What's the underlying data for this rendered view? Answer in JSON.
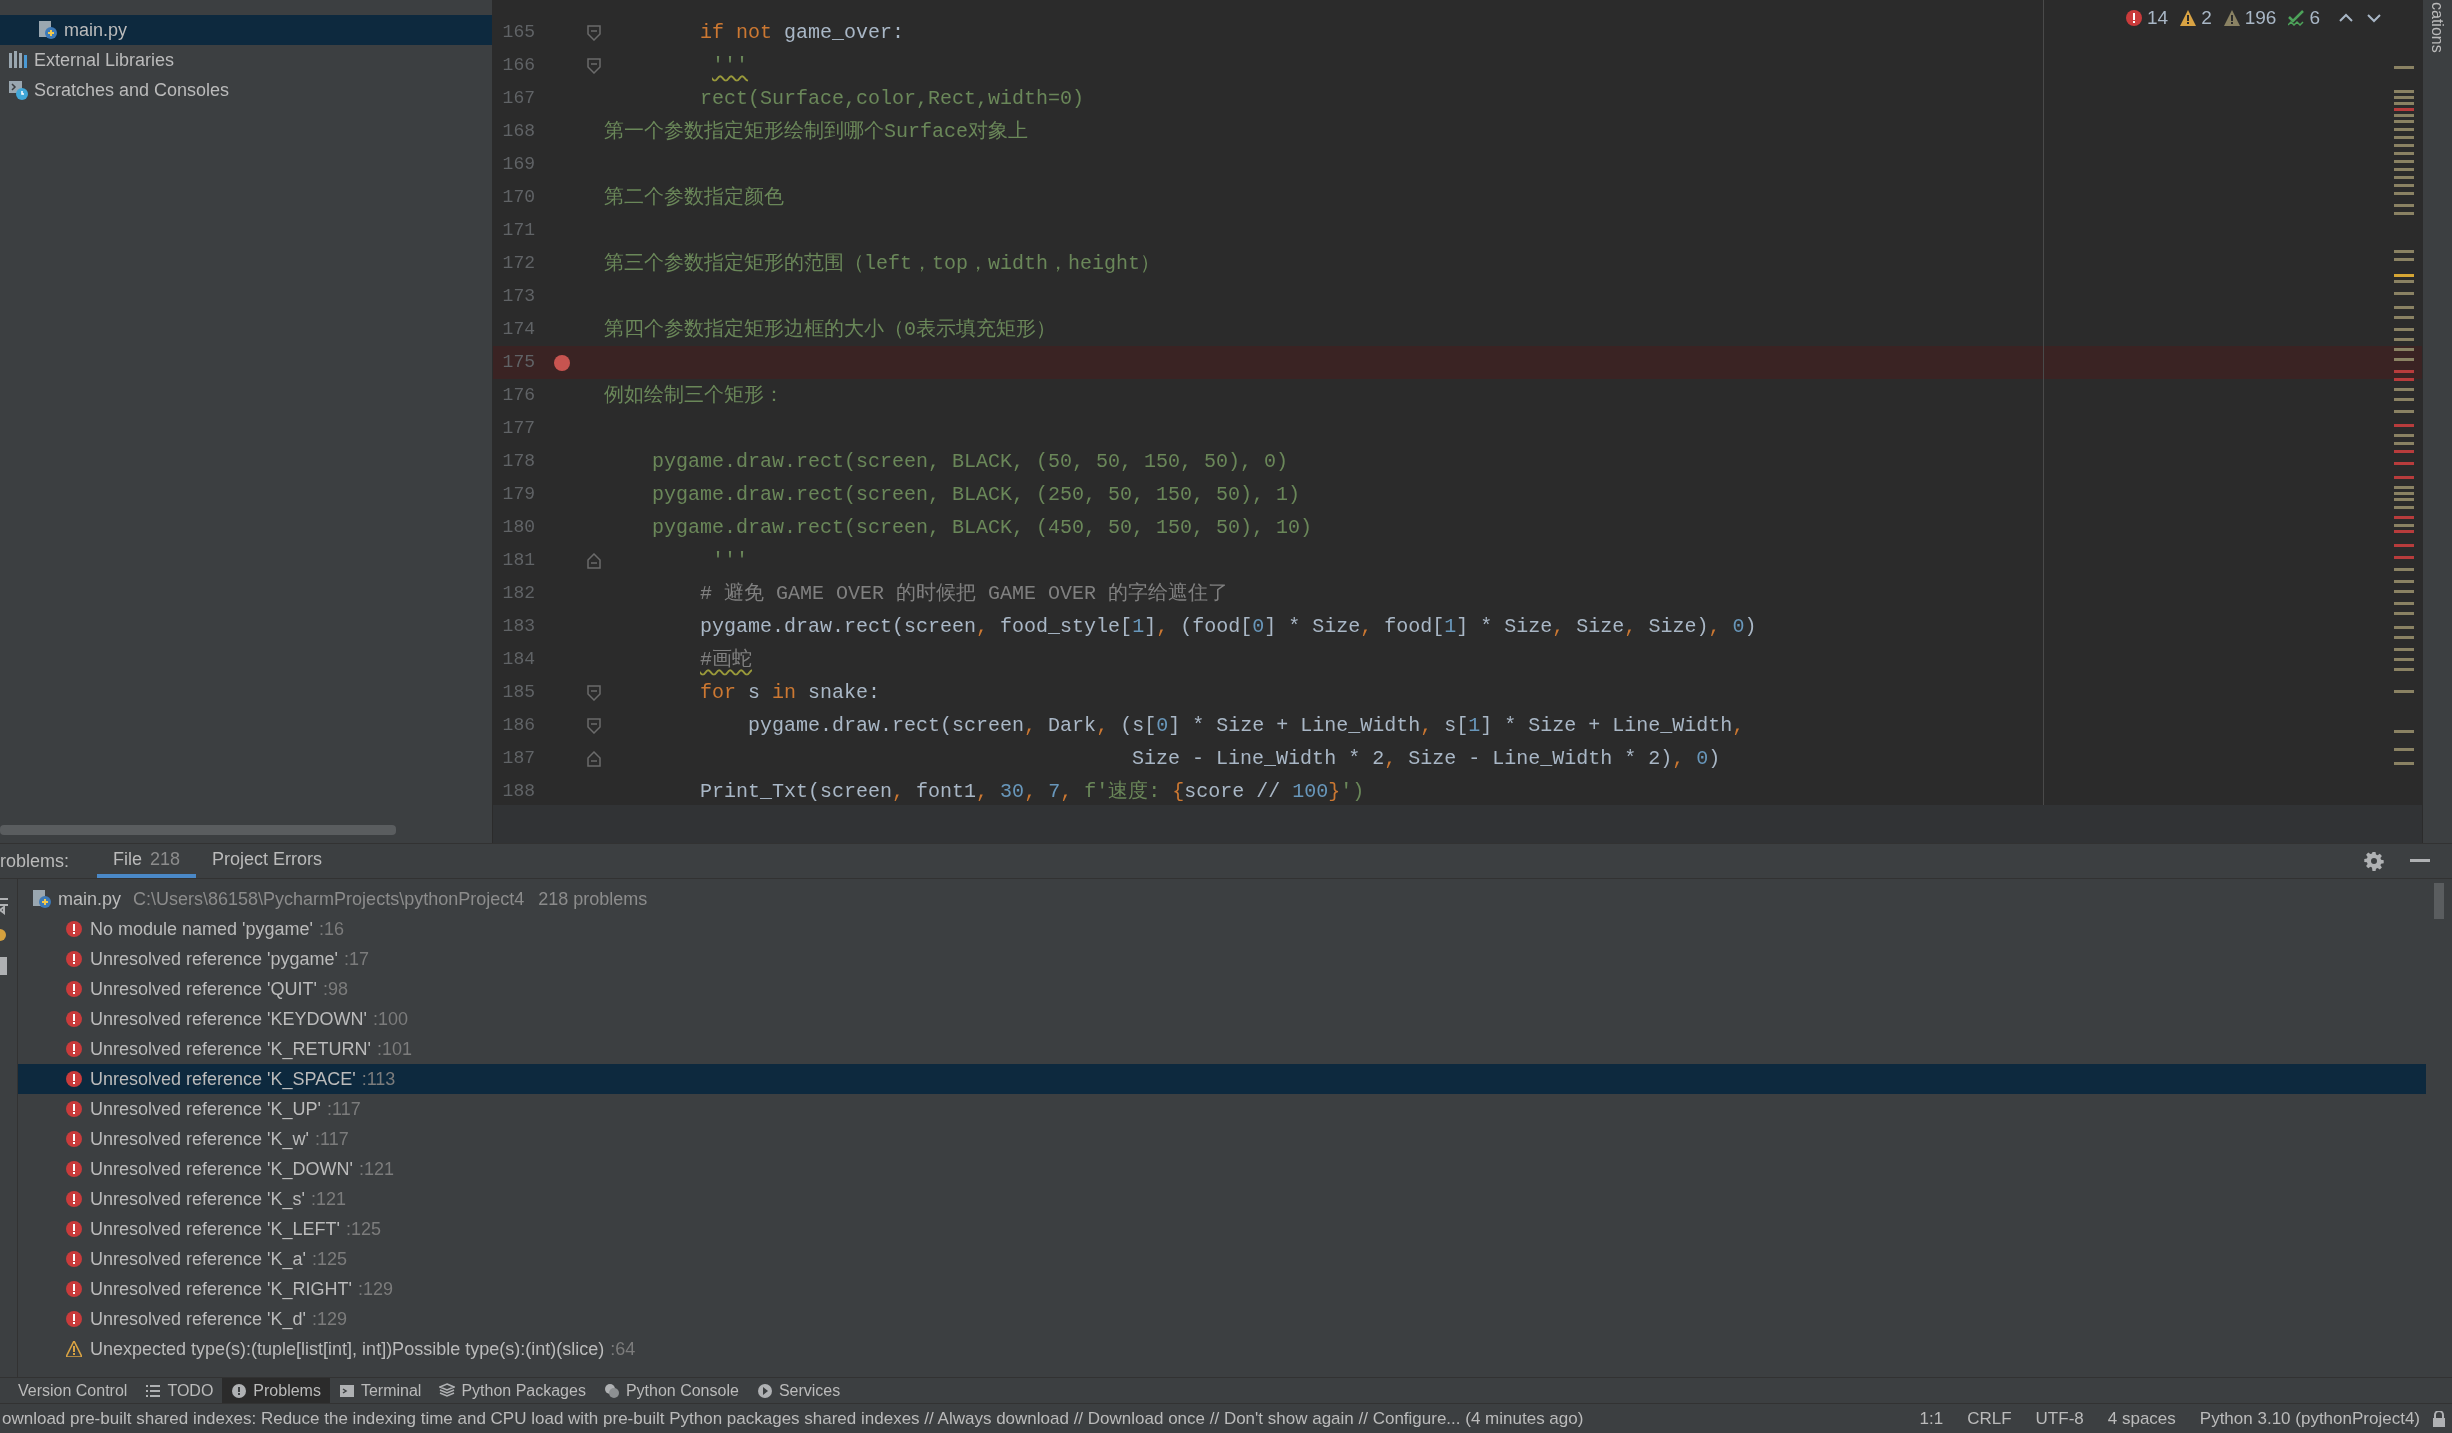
{
  "project_tree": [
    {
      "kind": "python_file",
      "label": "main.py",
      "selected": true
    },
    {
      "kind": "libraries",
      "label": "External Libraries",
      "selected": false
    },
    {
      "kind": "scratches",
      "label": "Scratches and Consoles",
      "selected": false
    }
  ],
  "editor": {
    "inspections": [
      {
        "kind": "error",
        "count": "14"
      },
      {
        "kind": "warning",
        "count": "2"
      },
      {
        "kind": "weak_warning",
        "count": "196"
      },
      {
        "kind": "typo",
        "count": "6"
      }
    ],
    "lines": [
      {
        "number": "165",
        "fold": {
          "kind": "start"
        },
        "tokens": [
          {
            "kind": "keyword",
            "text": "        if not"
          },
          {
            "kind": "plain",
            "text": " game_over:"
          }
        ]
      },
      {
        "number": "166",
        "fold": {
          "kind": "start"
        },
        "tokens": [
          {
            "kind": "string",
            "text": "         '''",
            "squiggle": true
          }
        ]
      },
      {
        "number": "167",
        "tokens": [
          {
            "kind": "string",
            "text": "        rect(Surface,color,Rect,width=0)"
          }
        ]
      },
      {
        "number": "168",
        "tokens": [
          {
            "kind": "string",
            "text": "第一个参数指定矩形绘制到哪个Surface对象上"
          }
        ]
      },
      {
        "number": "169"
      },
      {
        "number": "170",
        "tokens": [
          {
            "kind": "string",
            "text": "第二个参数指定颜色"
          }
        ]
      },
      {
        "number": "171"
      },
      {
        "number": "172",
        "tokens": [
          {
            "kind": "string",
            "text": "第三个参数指定矩形的范围（left，top，width，height）"
          }
        ]
      },
      {
        "number": "173"
      },
      {
        "number": "174",
        "tokens": [
          {
            "kind": "string",
            "text": "第四个参数指定矩形边框的大小（0表示填充矩形）"
          }
        ]
      },
      {
        "number": "175",
        "breakpoint": true
      },
      {
        "number": "176",
        "tokens": [
          {
            "kind": "string",
            "text": "例如绘制三个矩形："
          }
        ]
      },
      {
        "number": "177"
      },
      {
        "number": "178",
        "tokens": [
          {
            "kind": "string",
            "text": "    pygame.draw.rect(screen, BLACK, (50, 50, 150, 50), 0)"
          }
        ]
      },
      {
        "number": "179",
        "tokens": [
          {
            "kind": "string",
            "text": "    pygame.draw.rect(screen, BLACK, (250, 50, 150, 50), 1)"
          }
        ]
      },
      {
        "number": "180",
        "tokens": [
          {
            "kind": "string",
            "text": "    pygame.draw.rect(screen, BLACK, (450, 50, 150, 50), 10)"
          }
        ]
      },
      {
        "number": "181",
        "fold": {
          "kind": "end"
        },
        "tokens": [
          {
            "kind": "string",
            "text": "         '''"
          }
        ]
      },
      {
        "number": "182",
        "tokens": [
          {
            "kind": "comment",
            "text": "        # 避免 GAME OVER 的时候把 GAME OVER 的字给遮住了"
          }
        ]
      },
      {
        "number": "183",
        "tokens": [
          {
            "kind": "plain",
            "text": "        pygame.draw.rect(screen"
          },
          {
            "kind": "punct",
            "text": ","
          },
          {
            "kind": "plain",
            "text": " food_style["
          },
          {
            "kind": "number",
            "text": "1"
          },
          {
            "kind": "plain",
            "text": "]"
          },
          {
            "kind": "punct",
            "text": ","
          },
          {
            "kind": "plain",
            "text": " (food["
          },
          {
            "kind": "number",
            "text": "0"
          },
          {
            "kind": "plain",
            "text": "] * Size"
          },
          {
            "kind": "punct",
            "text": ","
          },
          {
            "kind": "plain",
            "text": " food["
          },
          {
            "kind": "number",
            "text": "1"
          },
          {
            "kind": "plain",
            "text": "] * Size"
          },
          {
            "kind": "punct",
            "text": ","
          },
          {
            "kind": "plain",
            "text": " Size"
          },
          {
            "kind": "punct",
            "text": ","
          },
          {
            "kind": "plain",
            "text": " Size)"
          },
          {
            "kind": "punct",
            "text": ", "
          },
          {
            "kind": "number",
            "text": "0"
          },
          {
            "kind": "plain",
            "text": ")"
          }
        ]
      },
      {
        "number": "184",
        "tokens": [
          {
            "kind": "comment",
            "text": "        #画蛇",
            "squiggle": true
          }
        ]
      },
      {
        "number": "185",
        "fold": {
          "kind": "start"
        },
        "tokens": [
          {
            "kind": "keyword",
            "text": "        for"
          },
          {
            "kind": "plain",
            "text": " s "
          },
          {
            "kind": "keyword",
            "text": "in"
          },
          {
            "kind": "plain",
            "text": " snake:"
          }
        ]
      },
      {
        "number": "186",
        "fold": {
          "kind": "start"
        },
        "tokens": [
          {
            "kind": "plain",
            "text": "            pygame.draw.rect(screen"
          },
          {
            "kind": "punct",
            "text": ","
          },
          {
            "kind": "plain",
            "text": " Dark"
          },
          {
            "kind": "punct",
            "text": ","
          },
          {
            "kind": "plain",
            "text": " (s["
          },
          {
            "kind": "number",
            "text": "0"
          },
          {
            "kind": "plain",
            "text": "] * Size + Line_Width"
          },
          {
            "kind": "punct",
            "text": ","
          },
          {
            "kind": "plain",
            "text": " s["
          },
          {
            "kind": "number",
            "text": "1"
          },
          {
            "kind": "plain",
            "text": "] * Size + Line_Width"
          },
          {
            "kind": "punct",
            "text": ","
          }
        ]
      },
      {
        "number": "187",
        "fold": {
          "kind": "end"
        },
        "tokens": [
          {
            "kind": "plain",
            "text": "                                            Size - Line_Width * 2"
          },
          {
            "kind": "punct",
            "text": ","
          },
          {
            "kind": "plain",
            "text": " Size - Line_Width * 2)"
          },
          {
            "kind": "punct",
            "text": ", "
          },
          {
            "kind": "number",
            "text": "0"
          },
          {
            "kind": "plain",
            "text": ")"
          }
        ]
      },
      {
        "number": "188",
        "tokens": [
          {
            "kind": "plain",
            "text": "        Print_Txt(screen"
          },
          {
            "kind": "punct",
            "text": ","
          },
          {
            "kind": "plain",
            "text": " font1"
          },
          {
            "kind": "punct",
            "text": ", "
          },
          {
            "kind": "number",
            "text": "30"
          },
          {
            "kind": "punct",
            "text": ", "
          },
          {
            "kind": "number",
            "text": "7"
          },
          {
            "kind": "punct",
            "text": ", "
          },
          {
            "kind": "string",
            "text": "f'速度: "
          },
          {
            "kind": "punct",
            "text": "{"
          },
          {
            "kind": "plain",
            "text": "score // "
          },
          {
            "kind": "number",
            "text": "100"
          },
          {
            "kind": "punct",
            "text": "}"
          },
          {
            "kind": "string",
            "text": "')"
          }
        ]
      }
    ]
  },
  "right_strip": {
    "label": "cations"
  },
  "problems": {
    "title": "roblems:",
    "tabs": [
      {
        "label": "File",
        "count": "218",
        "selected": true
      },
      {
        "label": "Project Errors",
        "selected": false
      }
    ],
    "file": {
      "name": "main.py",
      "path": "C:\\Users\\86158\\PycharmProjects\\pythonProject4",
      "count": "218 problems"
    },
    "items": [
      {
        "kind": "error",
        "message": "No module named 'pygame'",
        "line": ":16",
        "selected": false
      },
      {
        "kind": "error",
        "message": "Unresolved reference 'pygame'",
        "line": ":17",
        "selected": false
      },
      {
        "kind": "error",
        "message": "Unresolved reference 'QUIT'",
        "line": ":98",
        "selected": false
      },
      {
        "kind": "error",
        "message": "Unresolved reference 'KEYDOWN'",
        "line": ":100",
        "selected": false
      },
      {
        "kind": "error",
        "message": "Unresolved reference 'K_RETURN'",
        "line": ":101",
        "selected": false
      },
      {
        "kind": "error",
        "message": "Unresolved reference 'K_SPACE'",
        "line": ":113",
        "selected": true
      },
      {
        "kind": "error",
        "message": "Unresolved reference 'K_UP'",
        "line": ":117",
        "selected": false
      },
      {
        "kind": "error",
        "message": "Unresolved reference 'K_w'",
        "line": ":117",
        "selected": false
      },
      {
        "kind": "error",
        "message": "Unresolved reference 'K_DOWN'",
        "line": ":121",
        "selected": false
      },
      {
        "kind": "error",
        "message": "Unresolved reference 'K_s'",
        "line": ":121",
        "selected": false
      },
      {
        "kind": "error",
        "message": "Unresolved reference 'K_LEFT'",
        "line": ":125",
        "selected": false
      },
      {
        "kind": "error",
        "message": "Unresolved reference 'K_a'",
        "line": ":125",
        "selected": false
      },
      {
        "kind": "error",
        "message": "Unresolved reference 'K_RIGHT'",
        "line": ":129",
        "selected": false
      },
      {
        "kind": "error",
        "message": "Unresolved reference 'K_d'",
        "line": ":129",
        "selected": false
      },
      {
        "kind": "warning",
        "message": "Unexpected type(s):(tuple[list[int], int])Possible type(s):(int)(slice)",
        "line": ":64",
        "selected": false
      }
    ]
  },
  "tool_windows": [
    {
      "kind": "vcs",
      "label": "Version Control",
      "selected": false
    },
    {
      "kind": "todo",
      "label": "TODO",
      "selected": false
    },
    {
      "kind": "problems",
      "label": "Problems",
      "selected": true
    },
    {
      "kind": "terminal",
      "label": "Terminal",
      "selected": false
    },
    {
      "kind": "packages",
      "label": "Python Packages",
      "selected": false
    },
    {
      "kind": "console",
      "label": "Python Console",
      "selected": false
    },
    {
      "kind": "services",
      "label": "Services",
      "selected": false
    }
  ],
  "status_bar": {
    "message": "ownload pre-built shared indexes: Reduce the indexing time and CPU load with pre-built Python packages shared indexes // Always download // Download once // Don't show again // Configure... (4 minutes ago)",
    "fields": [
      "1:1",
      "CRLF",
      "UTF-8",
      "4 spaces",
      "Python 3.10 (pythonProject4)"
    ]
  }
}
